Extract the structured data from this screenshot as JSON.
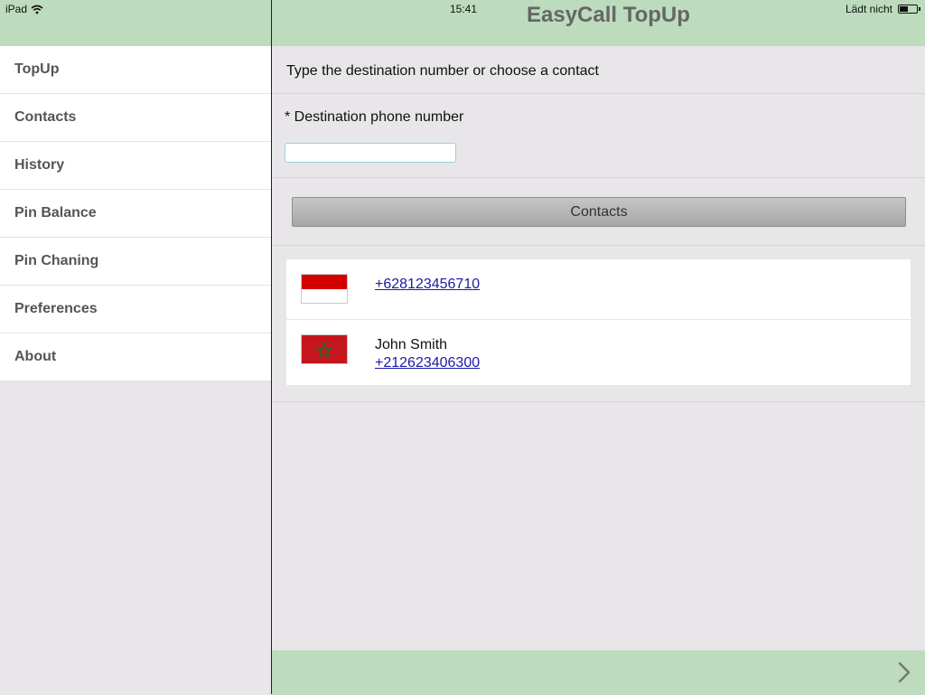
{
  "status_bar": {
    "device": "iPad",
    "time": "15:41",
    "battery_text": "Lädt nicht",
    "wifi_icon": "wifi-icon",
    "battery_icon": "battery-icon"
  },
  "app": {
    "title": "EasyCall TopUp"
  },
  "sidebar": {
    "items": [
      {
        "label": "TopUp"
      },
      {
        "label": "Contacts"
      },
      {
        "label": "History"
      },
      {
        "label": "Pin Balance"
      },
      {
        "label": "Pin Chaning"
      },
      {
        "label": "Preferences"
      },
      {
        "label": "About"
      }
    ]
  },
  "main": {
    "intro_text": "Type the destination number or choose a contact",
    "phone_label": "* Destination phone number",
    "phone_value": "",
    "contacts_button_label": "Contacts",
    "recent": [
      {
        "flag": "indonesia-flag-icon",
        "name": "",
        "number": "+628123456710"
      },
      {
        "flag": "morocco-flag-icon",
        "name": "John Smith",
        "number": "+212623406300"
      }
    ]
  },
  "footer": {
    "next_icon": "chevron-right-icon"
  },
  "colors": {
    "header_green": "#bddbbd",
    "background": "#e8e6e8",
    "link": "#1a1aa6"
  }
}
